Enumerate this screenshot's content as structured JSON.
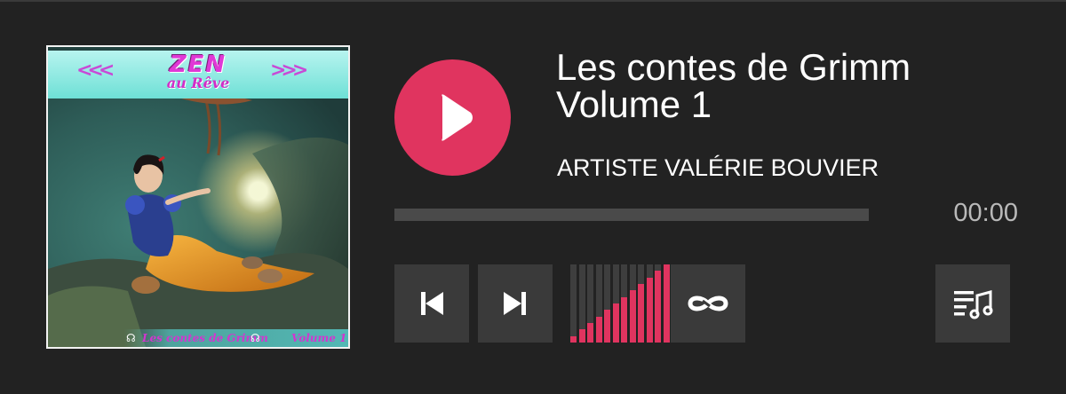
{
  "player": {
    "title": "Les contes de Grimm\nVolume 1",
    "artist": "ARTISTE VALÉRIE BOUVIER",
    "time": "00:00",
    "progress_fraction": 0,
    "volume_fraction": 1.0,
    "accent_color": "#e0345f",
    "background_color": "#222222"
  },
  "cover": {
    "brand_main": "ZEN",
    "brand_sub": "au Rêve",
    "footer_title": "Les contes de Grimm",
    "footer_volume": "Volume 1"
  },
  "controls": {
    "play_icon": "play-icon",
    "prev_icon": "skip-previous-icon",
    "next_icon": "skip-next-icon",
    "loop_icon": "repeat-infinity-icon",
    "playlist_icon": "playlist-music-icon"
  }
}
